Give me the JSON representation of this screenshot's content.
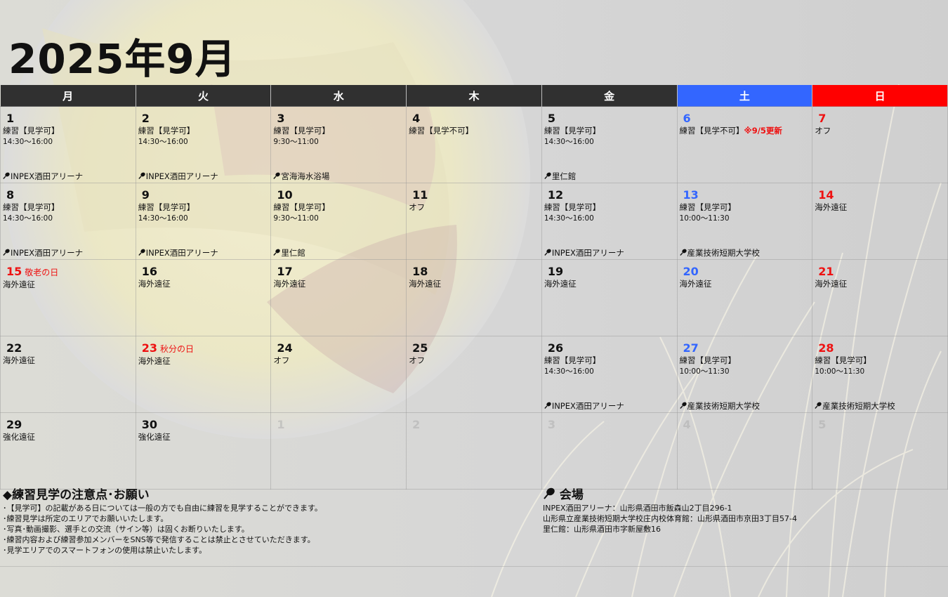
{
  "title": "2025年9月",
  "colors": {
    "header_dark": "#303030",
    "saturday": "#3366ff",
    "sunday": "#ff0000",
    "holiday_text": "#ee1111"
  },
  "weekdays": [
    "月",
    "火",
    "水",
    "木",
    "金",
    "土",
    "日"
  ],
  "weeks": [
    [
      {
        "day": "1",
        "event": "練習【見学可】",
        "time": "14:30〜16:00",
        "venue": "INPEX酒田アリーナ"
      },
      {
        "day": "2",
        "event": "練習【見学可】",
        "time": "14:30〜16:00",
        "venue": "INPEX酒田アリーナ"
      },
      {
        "day": "3",
        "event": "練習【見学可】",
        "time": "9:30〜11:00",
        "venue": "宮海海水浴場"
      },
      {
        "day": "4",
        "event": "練習【見学不可】",
        "time": "",
        "venue": ""
      },
      {
        "day": "5",
        "event": "練習【見学可】",
        "time": "14:30〜16:00",
        "venue": "里仁館"
      },
      {
        "day": "6",
        "event": "練習【見学不可】",
        "note": "※9/5更新",
        "time": "",
        "venue": ""
      },
      {
        "day": "7",
        "event": "オフ",
        "time": "",
        "venue": ""
      }
    ],
    [
      {
        "day": "8",
        "event": "練習【見学可】",
        "time": "14:30〜16:00",
        "venue": "INPEX酒田アリーナ"
      },
      {
        "day": "9",
        "event": "練習【見学可】",
        "time": "14:30〜16:00",
        "venue": "INPEX酒田アリーナ"
      },
      {
        "day": "10",
        "event": "練習【見学可】",
        "time": "9:30〜11:00",
        "venue": "里仁館"
      },
      {
        "day": "11",
        "event": "オフ",
        "time": "",
        "venue": ""
      },
      {
        "day": "12",
        "event": "練習【見学可】",
        "time": "14:30〜16:00",
        "venue": "INPEX酒田アリーナ"
      },
      {
        "day": "13",
        "event": "練習【見学可】",
        "time": "10:00〜11:30",
        "venue": "産業技術短期大学校"
      },
      {
        "day": "14",
        "event": "海外遠征",
        "time": "",
        "venue": ""
      }
    ],
    [
      {
        "day": "15",
        "holiday": "敬老の日",
        "event": "海外遠征",
        "time": "",
        "venue": ""
      },
      {
        "day": "16",
        "event": "海外遠征",
        "time": "",
        "venue": ""
      },
      {
        "day": "17",
        "event": "海外遠征",
        "time": "",
        "venue": ""
      },
      {
        "day": "18",
        "event": "海外遠征",
        "time": "",
        "venue": ""
      },
      {
        "day": "19",
        "event": "海外遠征",
        "time": "",
        "venue": ""
      },
      {
        "day": "20",
        "event": "海外遠征",
        "time": "",
        "venue": ""
      },
      {
        "day": "21",
        "event": "海外遠征",
        "time": "",
        "venue": ""
      }
    ],
    [
      {
        "day": "22",
        "event": "海外遠征",
        "time": "",
        "venue": ""
      },
      {
        "day": "23",
        "holiday": "秋分の日",
        "event": "海外遠征",
        "time": "",
        "venue": ""
      },
      {
        "day": "24",
        "event": "オフ",
        "time": "",
        "venue": ""
      },
      {
        "day": "25",
        "event": "オフ",
        "time": "",
        "venue": ""
      },
      {
        "day": "26",
        "event": "練習【見学可】",
        "time": "14:30〜16:00",
        "venue": "INPEX酒田アリーナ"
      },
      {
        "day": "27",
        "event": "練習【見学可】",
        "time": "10:00〜11:30",
        "venue": "産業技術短期大学校"
      },
      {
        "day": "28",
        "event": "練習【見学可】",
        "time": "10:00〜11:30",
        "venue": "産業技術短期大学校"
      }
    ],
    [
      {
        "day": "29",
        "event": "強化遠征",
        "time": "",
        "venue": ""
      },
      {
        "day": "30",
        "event": "強化遠征",
        "time": "",
        "venue": ""
      },
      {
        "day": "1",
        "faded": true,
        "event": "",
        "time": "",
        "venue": ""
      },
      {
        "day": "2",
        "faded": true,
        "event": "",
        "time": "",
        "venue": ""
      },
      {
        "day": "3",
        "faded": true,
        "event": "",
        "time": "",
        "venue": ""
      },
      {
        "day": "4",
        "faded": true,
        "event": "",
        "time": "",
        "venue": ""
      },
      {
        "day": "5",
        "faded": true,
        "event": "",
        "time": "",
        "venue": ""
      }
    ]
  ],
  "notes": {
    "heading": "◆練習見学の注意点･お願い",
    "lines": [
      "･【見学可】の記載がある日については一般の方でも自由に練習を見学することができます。",
      "･練習見学は所定のエリアでお願いいたします。",
      "･写真･動画撮影、選手との交流（サイン等）は固くお断りいたします。",
      "･練習内容および練習参加メンバーをSNS等で発信することは禁止とさせていただきます。",
      "･見学エリアでのスマートフォンの使用は禁止いたします。"
    ]
  },
  "venues": {
    "heading": "会場",
    "icon": "pin-icon",
    "lines": [
      "INPEX酒田アリーナ：山形県酒田市飯森山2丁目296-1",
      "山形県立産業技術短期大学校庄内校体育館：山形県酒田市京田3丁目57-4",
      "里仁館：山形県酒田市字新屋敷16"
    ]
  }
}
